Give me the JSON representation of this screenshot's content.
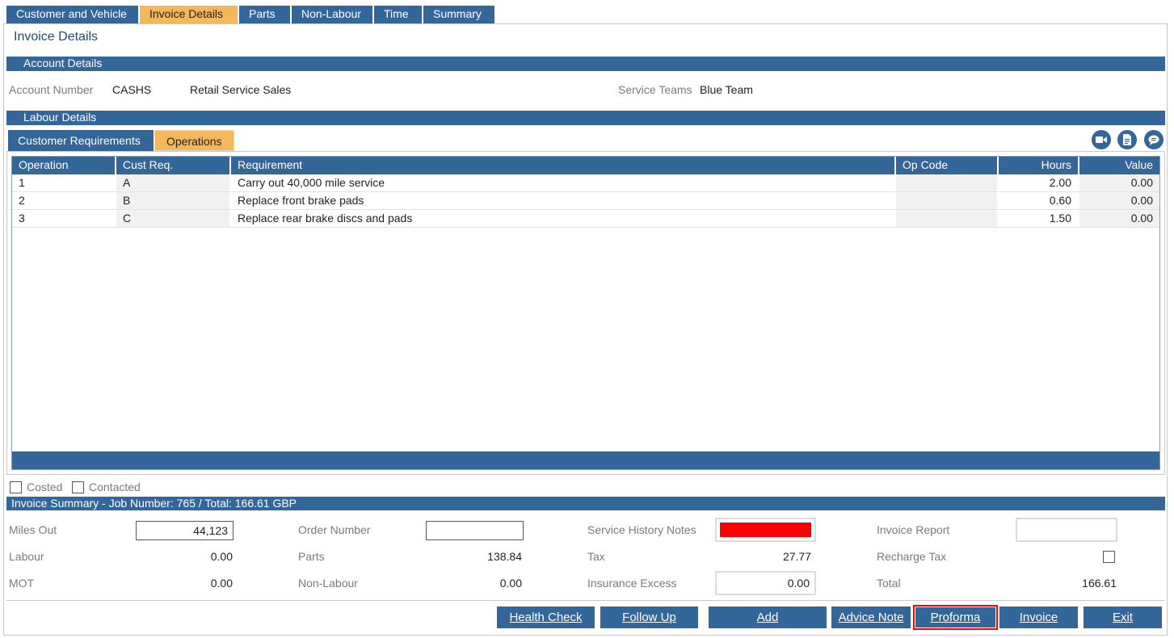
{
  "top_tabs": [
    "Customer and Vehicle",
    "Invoice Details",
    "Parts",
    "Non-Labour",
    "Time",
    "Summary"
  ],
  "page_title": "Invoice Details",
  "account_section": {
    "title": "Account Details",
    "account_number_label": "Account Number",
    "account_number": "CASHS",
    "account_name": "Retail Service Sales",
    "service_teams_label": "Service Teams",
    "service_team": "Blue Team"
  },
  "labour_section": {
    "title": "Labour Details"
  },
  "sub_tabs": [
    "Customer Requirements",
    "Operations"
  ],
  "toolbar_icons": [
    "video-icon",
    "document-icon",
    "comment-icon"
  ],
  "grid": {
    "headers": [
      "Operation",
      "Cust Req.",
      "Requirement",
      "Op Code",
      "Hours",
      "Value"
    ],
    "rows": [
      {
        "operation": "1",
        "cust_req": "A",
        "requirement": "Carry out 40,000 mile service",
        "op_code": "",
        "hours": "2.00",
        "value": "0.00"
      },
      {
        "operation": "2",
        "cust_req": "B",
        "requirement": "Replace front brake pads",
        "op_code": "",
        "hours": "0.60",
        "value": "0.00"
      },
      {
        "operation": "3",
        "cust_req": "C",
        "requirement": "Replace rear brake discs and pads",
        "op_code": "",
        "hours": "1.50",
        "value": "0.00"
      }
    ]
  },
  "checkboxes": {
    "costed": "Costed",
    "contacted": "Contacted"
  },
  "summary": {
    "title": "Invoice Summary - Job Number: 765 / Total: 166.61 GBP",
    "miles_out_label": "Miles Out",
    "miles_out": "44,123",
    "order_number_label": "Order Number",
    "order_number": "",
    "service_history_notes_label": "Service History Notes",
    "invoice_report_label": "Invoice Report",
    "invoice_report": "",
    "labour_label": "Labour",
    "labour": "0.00",
    "parts_label": "Parts",
    "parts": "138.84",
    "tax_label": "Tax",
    "tax": "27.77",
    "recharge_tax_label": "Recharge Tax",
    "mot_label": "MOT",
    "mot": "0.00",
    "non_labour_label": "Non-Labour",
    "non_labour": "0.00",
    "insurance_excess_label": "Insurance Excess",
    "insurance_excess": "0.00",
    "total_label": "Total",
    "total": "166.61"
  },
  "buttons": {
    "health_check": "Health Check",
    "follow_up": "Follow Up",
    "add": "Add",
    "advice_note": "Advice Note",
    "proforma": "Proforma",
    "invoice": "Invoice",
    "exit": "Exit"
  },
  "colors": {
    "primary": "#336699",
    "active_tab": "#f5b75c",
    "alert": "#ff0000"
  }
}
